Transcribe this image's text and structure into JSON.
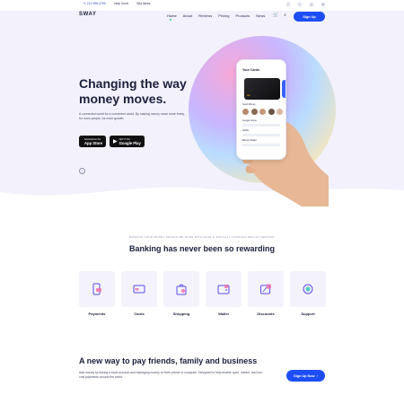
{
  "topbar": {
    "phone": "+1 212-999-4796",
    "help": "Help Centr",
    "news": "Sita News",
    "social_icons": [
      "facebook-icon",
      "twitter-icon",
      "instagram-icon",
      "linkedin-icon"
    ],
    "social_glyphs": [
      "f",
      "t",
      "◎",
      "in"
    ]
  },
  "navbar": {
    "logo": "SWAY",
    "links": [
      "Home",
      "About",
      "Reviews",
      "Pricing",
      "Products",
      "News"
    ],
    "cart_glyph": "🛒",
    "search_glyph": "⌕",
    "signup_label": "Sign Up"
  },
  "hero": {
    "title": "Changing the way money moves.",
    "subtitle": "A connected world for a connected world. By making money move more freely, for more people, for more growth.",
    "app_store": {
      "small": "Download on the",
      "big": "App Store",
      "glyph": ""
    },
    "google_play": {
      "small": "GET IT ON",
      "big": "Google Play",
      "glyph": "▶"
    },
    "down_glyph": "↓",
    "phone": {
      "header": "Your Cards",
      "card_brand": "●●",
      "recent": "Send Money",
      "items": [
        "Google Home",
        "Netflix",
        "Bitcoin Wallet"
      ]
    }
  },
  "features": {
    "eyebrow": "BANKING YOUR MONEY SHOULD BE DONE WITH EASE & SOCIALLY THROUGH WALLET SERVICE",
    "title": "Banking has never been so rewarding",
    "items": [
      {
        "label": "Payments",
        "icon": "phone-payment-icon"
      },
      {
        "label": "Cards",
        "icon": "card-icon"
      },
      {
        "label": "Shopping",
        "icon": "shopping-bag-icon"
      },
      {
        "label": "Wallet",
        "icon": "wallet-icon"
      },
      {
        "label": "Discounts",
        "icon": "discount-icon"
      },
      {
        "label": "Support",
        "icon": "support-icon"
      }
    ]
  },
  "new_way": {
    "title": "A new way to pay friends, family and business",
    "text": "Add money by linking a bank account and managing money on their phone or computer. Designed to help enable open, instant, and low-cost payments around the world.",
    "button_label": "Sign Up Now",
    "button_glyph": "›"
  },
  "colors": {
    "accent": "#1d4ef5",
    "hero_bg": "#f3f1fb",
    "feature_bg": "#f4f3fb",
    "icon_purple": "#5b4ee8",
    "icon_pink": "#f26aa6"
  }
}
